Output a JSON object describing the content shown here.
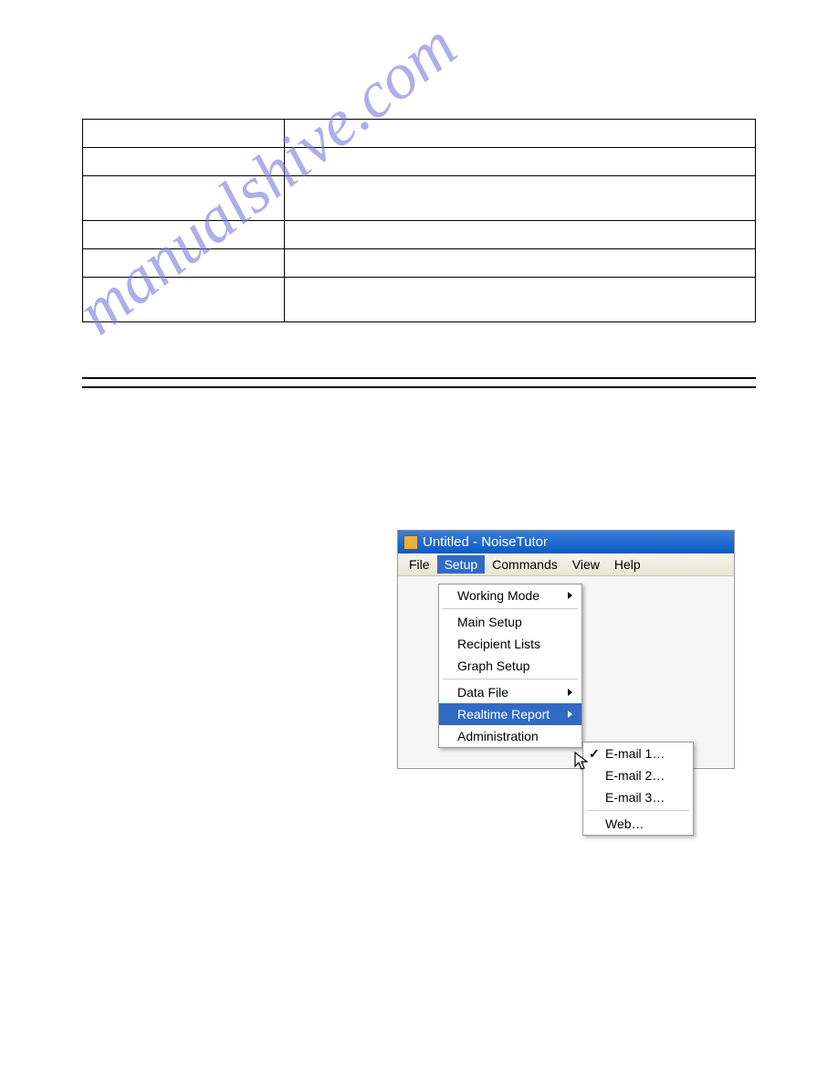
{
  "watermark": "manualshive.com",
  "screenshot": {
    "title": "Untitled - NoiseTutor",
    "menubar": [
      "File",
      "Setup",
      "Commands",
      "View",
      "Help"
    ],
    "active_menu_index": 1,
    "dropdown": {
      "groups": [
        [
          {
            "label": "Working Mode",
            "submenu": true
          }
        ],
        [
          {
            "label": "Main Setup"
          },
          {
            "label": "Recipient Lists"
          },
          {
            "label": "Graph Setup"
          }
        ],
        [
          {
            "label": "Data File",
            "submenu": true
          },
          {
            "label": "Realtime Report",
            "submenu": true,
            "highlighted": true
          },
          {
            "label": "Administration"
          }
        ]
      ]
    },
    "submenu": {
      "groups": [
        [
          {
            "label": "E-mail 1…",
            "checked": true
          },
          {
            "label": "E-mail 2…"
          },
          {
            "label": "E-mail 3…"
          }
        ],
        [
          {
            "label": "Web…"
          }
        ]
      ]
    }
  }
}
